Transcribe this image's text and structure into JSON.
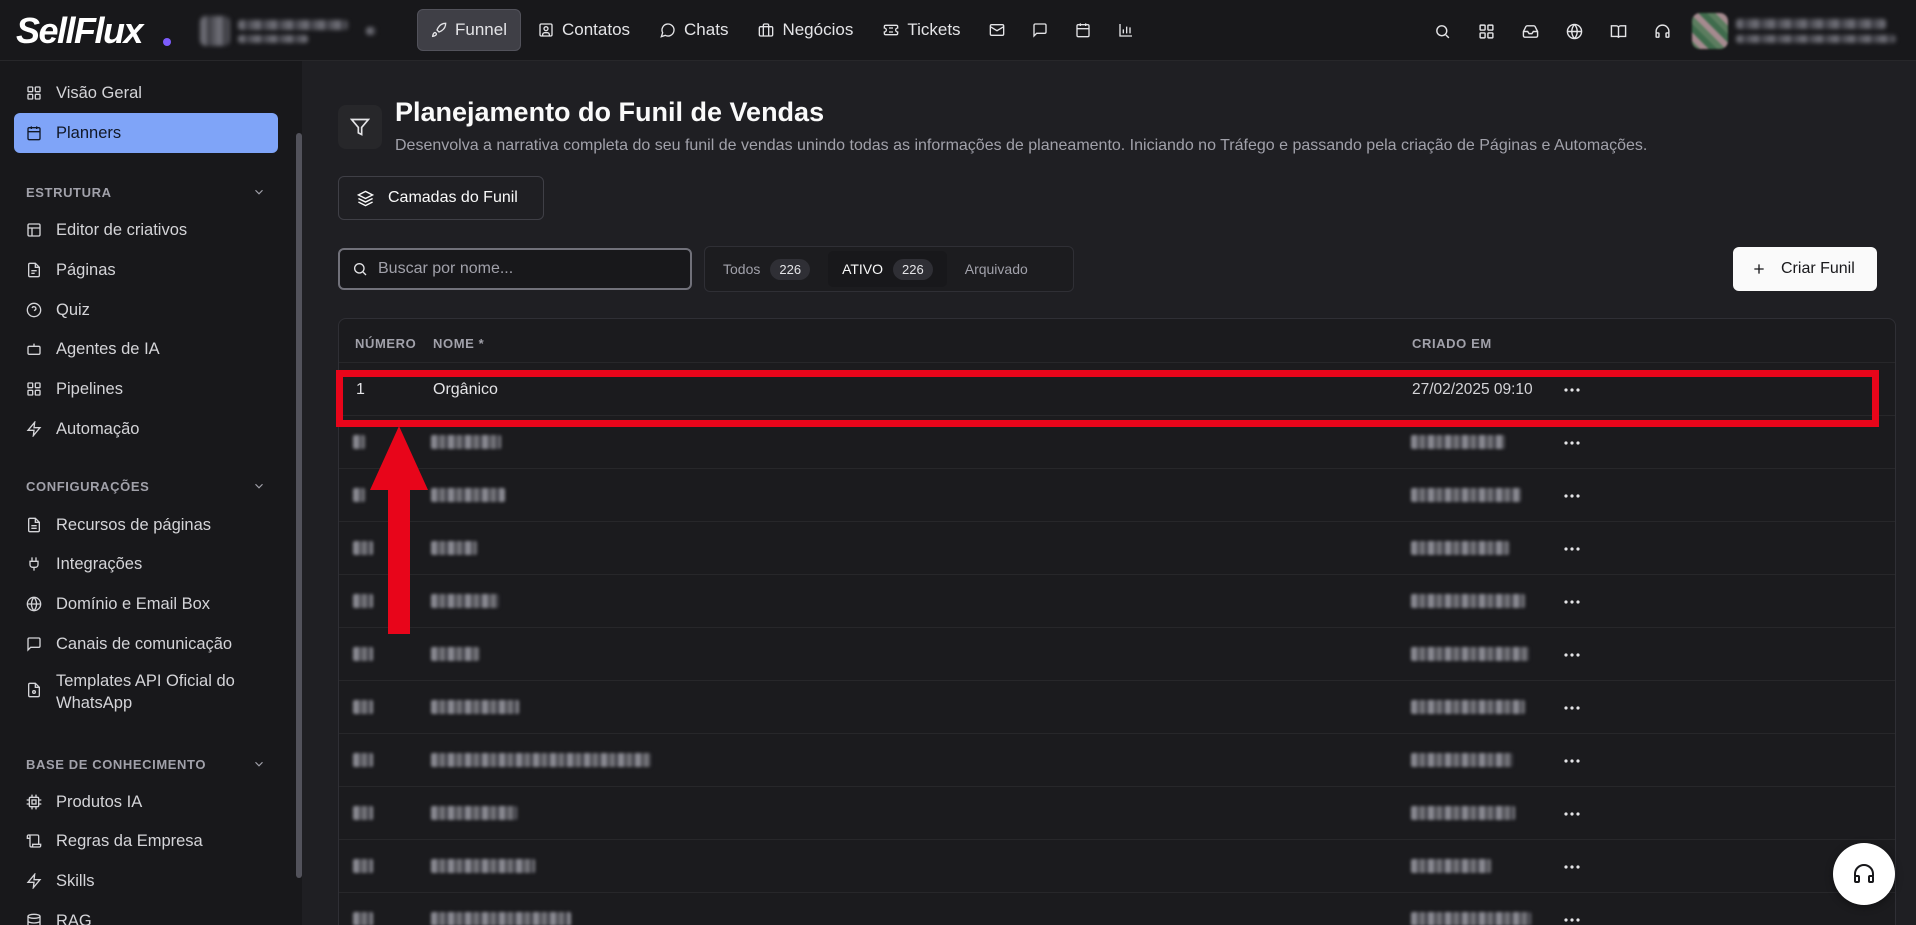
{
  "brand": {
    "logo_text": "SellFlux"
  },
  "nav": {
    "items": [
      {
        "label": "Funnel",
        "icon": "rocket-icon",
        "active": true
      },
      {
        "label": "Contatos",
        "icon": "contact-card-icon"
      },
      {
        "label": "Chats",
        "icon": "chat-bubble-icon"
      },
      {
        "label": "Negócios",
        "icon": "briefcase-icon"
      },
      {
        "label": "Tickets",
        "icon": "ticket-icon"
      }
    ],
    "icon_only": [
      "mail-icon",
      "message-square-icon",
      "calendar-icon",
      "bar-chart-icon"
    ]
  },
  "topright_icons": [
    "search-icon",
    "grid-icon",
    "inbox-icon",
    "globe-icon",
    "book-icon",
    "headset-icon"
  ],
  "sidebar": {
    "top_items": [
      {
        "label": "Visão Geral",
        "icon": "grid-icon"
      },
      {
        "label": "Planners",
        "icon": "calendar-icon",
        "active": true
      }
    ],
    "sections": [
      {
        "title": "ESTRUTURA",
        "items": [
          {
            "label": "Editor de criativos",
            "icon": "layout-icon"
          },
          {
            "label": "Páginas",
            "icon": "file-icon"
          },
          {
            "label": "Quiz",
            "icon": "question-circle-icon"
          },
          {
            "label": "Agentes de IA",
            "icon": "bot-icon"
          },
          {
            "label": "Pipelines",
            "icon": "grid-icon"
          },
          {
            "label": "Automação",
            "icon": "zap-icon"
          }
        ]
      },
      {
        "title": "CONFIGURAÇÕES",
        "items": [
          {
            "label": "Recursos de páginas",
            "icon": "file-text-icon"
          },
          {
            "label": "Integrações",
            "icon": "plug-icon"
          },
          {
            "label": "Domínio e Email Box",
            "icon": "globe-icon"
          },
          {
            "label": "Canais de comunicação",
            "icon": "message-square-icon"
          },
          {
            "label": "Templates API Oficial do WhatsApp",
            "icon": "file-code-icon"
          }
        ]
      },
      {
        "title": "BASE DE CONHECIMENTO",
        "items": [
          {
            "label": "Produtos IA",
            "icon": "cpu-icon"
          },
          {
            "label": "Regras da Empresa",
            "icon": "scroll-icon"
          },
          {
            "label": "Skills",
            "icon": "zap-icon"
          },
          {
            "label": "RAG",
            "icon": "database-icon"
          }
        ]
      }
    ]
  },
  "page": {
    "title": "Planejamento do Funil de Vendas",
    "subtitle": "Desenvolva a narrativa completa do seu funil de vendas unindo todas as informações de planeamento. Iniciando no Tráfego e passando pela criação de Páginas e Automações.",
    "layers_button": "Camadas do Funil",
    "search_placeholder": "Buscar por nome...",
    "tabs": [
      {
        "label": "Todos",
        "count": "226"
      },
      {
        "label": "ATIVO",
        "count": "226",
        "active": true
      },
      {
        "label": "Arquivado"
      }
    ],
    "create_button": "Criar Funil"
  },
  "table": {
    "columns": {
      "number": "NÚMERO",
      "name": "NOME *",
      "created": "CRIADO EM"
    },
    "first_row": {
      "number": "1",
      "name": "Orgânico",
      "created": "27/02/2025 09:10"
    },
    "blurred_rows": 9
  }
}
